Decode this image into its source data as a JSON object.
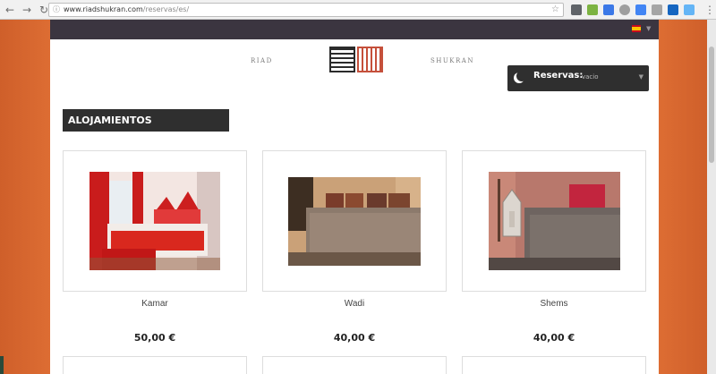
{
  "browser": {
    "url_domain": "www.riadshukran.com",
    "url_path": "/reservas/es/"
  },
  "site": {
    "nav_left": "RIAD",
    "nav_right": "SHUKRAN",
    "reservas_label": "Reservas:",
    "reservas_value": "vacio"
  },
  "section": {
    "title": "ALOJAMIENTOS DESTACADOS"
  },
  "rooms": [
    {
      "name": "Kamar",
      "price": "50,00 €"
    },
    {
      "name": "Wadi",
      "price": "40,00 €"
    },
    {
      "name": "Shems",
      "price": "40,00 €"
    }
  ],
  "colors": {
    "background_orange": "#d9672f",
    "topbar": "#3b3540",
    "dark_box": "#2f2f2f"
  }
}
